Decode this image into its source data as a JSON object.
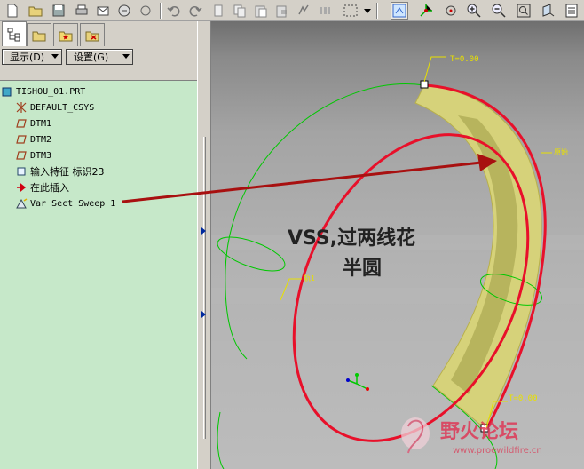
{
  "panel": {
    "show_menu": "显示(D)",
    "settings_menu": "设置(G)"
  },
  "tree": {
    "root": "TISHOU_01.PRT",
    "items": [
      {
        "label": "DEFAULT_CSYS",
        "icon": "csys-icon"
      },
      {
        "label": "DTM1",
        "icon": "datum-plane-icon"
      },
      {
        "label": "DTM2",
        "icon": "datum-plane-icon"
      },
      {
        "label": "DTM3",
        "icon": "datum-plane-icon"
      },
      {
        "label": "输入特征 标识23",
        "icon": "import-feature-icon"
      },
      {
        "label": "在此插入",
        "icon": "insert-here-arrow-icon"
      },
      {
        "label": "Var Sect Sweep 1",
        "icon": "sweep-feature-icon"
      }
    ]
  },
  "viewport": {
    "label_top": "T=0.00",
    "label_bottom": "T=0.00",
    "label_origin": "原始",
    "label_left": "轨1",
    "annotation_line1": "VSS,过两线花",
    "annotation_line2": "半圆",
    "watermark_cn": "野火论坛",
    "watermark_url": "www.proewildfire.cn"
  },
  "colors": {
    "tree_bg": "#c6e8c9",
    "trajectory_red": "#e8102a",
    "sweep_yellow": "#d6d27a",
    "curve_green": "#00c800",
    "arrow_red": "#a81010"
  }
}
